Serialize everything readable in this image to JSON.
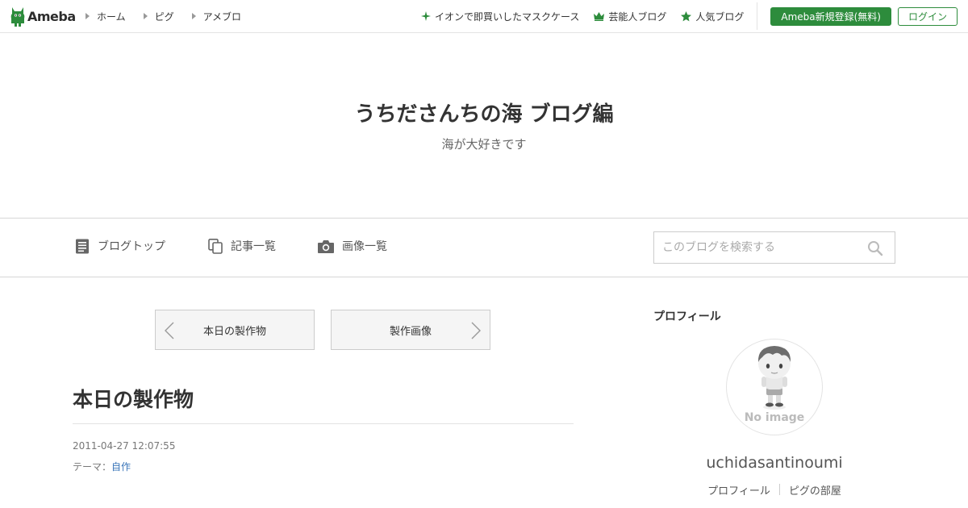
{
  "topbar": {
    "logo_text": "Ameba",
    "nav": [
      {
        "label": "ホーム"
      },
      {
        "label": "ピグ"
      },
      {
        "label": "アメブロ"
      }
    ],
    "links": [
      {
        "label": "イオンで即買いしたマスクケース",
        "icon": "sparkle-icon"
      },
      {
        "label": "芸能人ブログ",
        "icon": "crown-icon"
      },
      {
        "label": "人気ブログ",
        "icon": "star-icon"
      }
    ],
    "register_label": "Ameba新規登録(無料)",
    "login_label": "ログイン"
  },
  "header": {
    "title": "うちださんちの海 ブログ編",
    "description": "海が大好きです"
  },
  "blog_nav": {
    "items": [
      {
        "label": "ブログトップ",
        "icon": "document-icon"
      },
      {
        "label": "記事一覧",
        "icon": "copy-icon"
      },
      {
        "label": "画像一覧",
        "icon": "camera-icon"
      }
    ],
    "search_placeholder": "このブログを検索する"
  },
  "pager": {
    "prev_label": "本日の製作物",
    "next_label": "製作画像"
  },
  "entry": {
    "title": "本日の製作物",
    "date": "2011-04-27 12:07:55",
    "theme_label": "テーマ：",
    "theme_value": "自作"
  },
  "sidebar": {
    "heading": "プロフィール",
    "avatar_text": "No image",
    "name": "uchidasantinoumi",
    "links": [
      {
        "label": "プロフィール"
      },
      {
        "label": "ピグの部屋"
      }
    ]
  },
  "colors": {
    "brand_green": "#2d8c3c",
    "link_blue": "#3974b8"
  }
}
